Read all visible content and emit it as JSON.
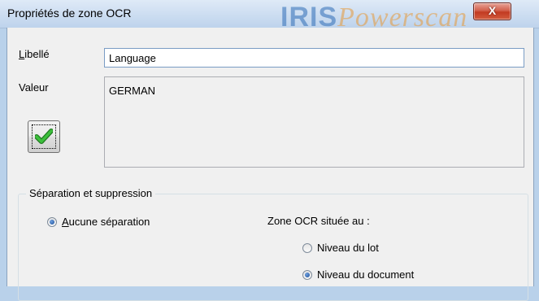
{
  "window": {
    "title": "Propriétés de zone OCR",
    "watermark": "IRISPowerscan",
    "close_glyph": "X"
  },
  "form": {
    "libelle_label_underlined": "L",
    "libelle_label_rest": "ibellé",
    "libelle_value": "Language",
    "valeur_label": "Valeur",
    "valeur_value": "GERMAN",
    "validate_icon": "checkmark-icon"
  },
  "separation": {
    "legend": "Séparation et suppression",
    "aucune_underlined": "A",
    "aucune_rest": "ucune séparation",
    "aucune_checked": true,
    "zone_label": "Zone OCR située au :",
    "options": [
      {
        "label": "Niveau du lot",
        "checked": false
      },
      {
        "label": "Niveau du document",
        "checked": true
      }
    ]
  },
  "colors": {
    "accent": "#2f6db7",
    "check_green": "#2e9e2e",
    "close_red": "#c23a22"
  }
}
